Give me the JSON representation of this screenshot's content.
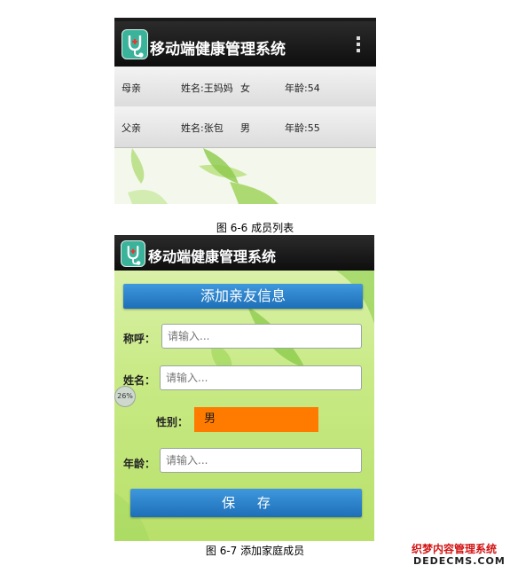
{
  "screen1": {
    "app_title": "移动端健康管理系统",
    "members": [
      {
        "relation": "母亲",
        "name": "姓名:王妈妈",
        "gender": "女",
        "age": "年龄:54"
      },
      {
        "relation": "父亲",
        "name": "姓名:张包",
        "gender": "男",
        "age": "年龄:55"
      }
    ],
    "caption": "图 6-6 成员列表"
  },
  "screen2": {
    "app_title": "移动端健康管理系统",
    "header": "添加亲友信息",
    "fields": {
      "appellation_label": "称呼：",
      "name_label": "姓名：",
      "gender_label": "性别：",
      "age_label": "年龄：",
      "placeholder": "请输入...",
      "gender_value": "男"
    },
    "progress_text": "26%",
    "save_label": "保  存",
    "caption": "图 6-7 添加家庭成员"
  },
  "watermark": {
    "line1": "织梦内容管理系统",
    "line2": "DEDECMS.COM"
  },
  "colors": {
    "appbar": "#1a1a1a",
    "button_blue": "#2a7fc9",
    "gender_orange": "#ff7b00",
    "form_green": "#c9ea86",
    "watermark_red": "#d21414"
  }
}
